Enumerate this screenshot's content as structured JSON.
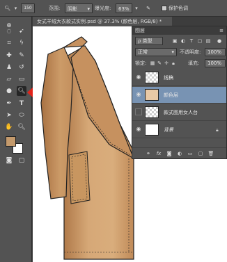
{
  "options": {
    "size": "150",
    "range_label": "范围:",
    "range_value": "阴影",
    "exposure_label": "曝光度:",
    "exposure_value": "63%",
    "protect_tone": "保护色调"
  },
  "document": {
    "tab_title": "女式羊绒大衣款式实例.psd @ 37.3% (颜色层, RGB/8) *"
  },
  "toolbox": {
    "foreground_color": "#c49a6c",
    "background_color": "#ffffff"
  },
  "layers_panel": {
    "title": "图层",
    "kind_filter": "ρ 类型",
    "blend_mode": "正常",
    "opacity_label": "不透明度:",
    "opacity_value": "100%",
    "lock_label": "锁定:",
    "fill_label": "填充:",
    "fill_value": "100%",
    "layers": [
      {
        "name": "线稿",
        "visible": true
      },
      {
        "name": "颜色层",
        "visible": true,
        "selected": true
      },
      {
        "name": "款式图用女人台",
        "visible": false
      },
      {
        "name": "背景",
        "visible": true,
        "locked": true
      }
    ]
  },
  "coat": {
    "fill_color": "#d3a574",
    "shade_color": "#b48052"
  },
  "colors": {
    "selection_highlight": "#7893b3",
    "arrow_red": "#e2231a"
  }
}
